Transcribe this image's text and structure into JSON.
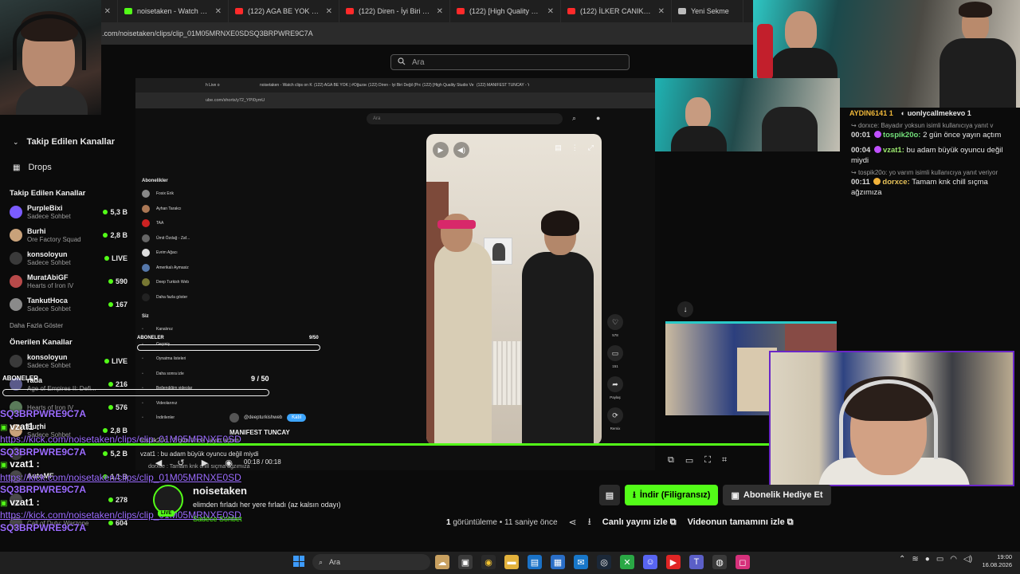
{
  "browser": {
    "tabs": [
      {
        "label": "ch",
        "color": "#2b2b2b"
      },
      {
        "label": "noisetaken - Watch clips",
        "color": "#53fc18"
      },
      {
        "label": "(122) AGA BE YOK #O",
        "color": "#ff2a2a"
      },
      {
        "label": "(122) Diren - İyi Biri Değil",
        "color": "#ff2a2a"
      },
      {
        "label": "(122) [High Quality Stud",
        "color": "#ff2a2a"
      },
      {
        "label": "(122) İLKER CANIKLIGİLI",
        "color": "#ff2a2a"
      },
      {
        "label": "Yeni Sekme",
        "color": "#bbbbbb"
      }
    ],
    "url": ".com/noisetaken/clips/clip_01M05MRNXE0SDSQ3BRPWRE9C7A",
    "search_placeholder": "Ara"
  },
  "sidebar": {
    "following_header": "Takip Edilen Kanallar",
    "drops": "Drops",
    "section_following": "Takip Edilen Kanallar",
    "following": [
      {
        "name": "PurpleBixi",
        "category": "Sadece Sohbet",
        "viewers": "5,3 B",
        "color": "#7b5cff"
      },
      {
        "name": "Burhi",
        "category": "Ore Factory Squad",
        "viewers": "2,8 B",
        "color": "#c9a27a"
      },
      {
        "name": "konsoloyun",
        "category": "Sadece Sohbet",
        "viewers": "LIVE",
        "color": "#3a3a3a"
      },
      {
        "name": "MuratAbiGF",
        "category": "Hearts of Iron IV",
        "viewers": "590",
        "color": "#b84a4a"
      },
      {
        "name": "TankutHoca",
        "category": "Sadece Sohbet",
        "viewers": "167",
        "color": "#8a8a8a"
      }
    ],
    "show_more": "Daha Fazla Göster",
    "section_recommended": "Önerilen Kanallar",
    "recommended": [
      {
        "name": "konsoloyun",
        "category": "Sadece Sohbet",
        "viewers": "LIVE",
        "color": "#3a3a3a"
      },
      {
        "name": "rada",
        "category": "Age of Empires II: Defi...",
        "viewers": "216",
        "color": "#5a5a8a"
      },
      {
        "name": "",
        "category": "Hearts of Iron IV",
        "viewers": "576",
        "color": "#5a7a5a"
      },
      {
        "name": "Burhi",
        "category": "Sadece Sohbet",
        "viewers": "2,8 B",
        "color": "#c9a27a"
      },
      {
        "name": "",
        "category": "",
        "viewers": "5,2 B",
        "color": "#3a3a3a"
      },
      {
        "name": "AutoMF",
        "category": "",
        "viewers": "1,1 B",
        "color": "#4a4a4a"
      },
      {
        "name": "",
        "category": "",
        "viewers": "278",
        "color": "#4a4a4a"
      },
      {
        "name": "",
        "category": "Call of Duty: Warzone",
        "viewers": "604",
        "color": "#4a4a4a"
      }
    ]
  },
  "chat": {
    "top_user_a": "AYDIN6141",
    "top_count_a": "1",
    "top_user_b": "uonlycallmekevo",
    "top_count_b": "1",
    "messages": [
      {
        "reply": "dorxce: Bayadır yoksun isimli kullanıcıya yanıt v",
        "time": "00:01",
        "user": "tospik20o:",
        "text": "2 gün önce yayın açtım",
        "badge": "#c050ff",
        "ucls": "u1"
      },
      {
        "reply": "",
        "time": "00:04",
        "user": "vzat1:",
        "text": "bu adam büyük oyuncu değil miydi",
        "badge": "#c050ff",
        "ucls": "u2"
      },
      {
        "reply": "tospik20o: yo varım isimli kullanıcıya yanıt veriyor",
        "time": "00:11",
        "user": "dorxce:",
        "text": "Tamam knk chill sıçma ağzımıza",
        "badge": "#f2b33a",
        "ucls": "u3"
      }
    ]
  },
  "shot": {
    "tabs": [
      "h Live o",
      "noisetaken - Watch clips on Ki",
      "(122) AGA BE YOK | #Oğuzse",
      "(122) Diren - İyi Biri Değil (Pro",
      "(122) [High Quality Studio Ve",
      "(122) MANIFEST TUNCAY - Yo"
    ],
    "url": "ube.com/shorts/y72_YPI0ymU",
    "search": "Ara",
    "subs_title": "Abonelikler",
    "subs": [
      {
        "name": "Fosix Erik",
        "color": "#888888"
      },
      {
        "name": "Ayhan Tarakcı",
        "color": "#aa7755"
      },
      {
        "name": "TAA",
        "color": "#cc2222"
      },
      {
        "name": "Ümit Özdağ - Zaf...",
        "color": "#666666"
      },
      {
        "name": "Evrim Ağacı",
        "color": "#dddddd"
      },
      {
        "name": "Amerikalı Aymasiz",
        "color": "#5577aa"
      },
      {
        "name": "Deep Turkish Web",
        "color": "#777733"
      },
      {
        "name": "Daha fazla göster",
        "color": "#222222"
      }
    ],
    "you_title": "Siz",
    "you_items": [
      "Kanalınız",
      "Geçmiş",
      "Oynatma listeleri",
      "Daha sonra izle",
      "Beğendiğim videolar",
      "Videolarınız",
      "İndirilenler"
    ],
    "likes": "578",
    "comments": "151",
    "share": "Paylaş",
    "remix": "Remix",
    "channel": "@deepturkishweb",
    "subscribe": "Katıl",
    "short_title": "MANIFEST TUNCAY",
    "time_display": "00:18 / 00:18"
  },
  "overlay": {
    "label": "ABONELER",
    "label2": "ABONELER",
    "count": "9/50",
    "count2": "9 / 50",
    "count3": "9 / 50",
    "small_chat_1": "tospik20o : 2 gün önce yayın açtım",
    "small_chat_2": "vzat1 : bu adam büyük oyuncu değil miydi",
    "small_chat_3": "dorxce : Tamam knk chill sıçma ağzımıza",
    "lines": [
      {
        "type": "code",
        "text": "SQ3BRPWRE9C7A"
      },
      {
        "type": "user",
        "text": "vzat1 :"
      },
      {
        "type": "link",
        "text": "https://kick.com/noisetaken/clips/clip_01M05MRNXE0SD"
      },
      {
        "type": "code",
        "text": "SQ3BRPWRE9C7A"
      },
      {
        "type": "user",
        "text": "vzat1 :"
      },
      {
        "type": "link",
        "text": "https://kick.com/noisetaken/clips/clip_01M05MRNXE0SD"
      },
      {
        "type": "code",
        "text": "SQ3BRPWRE9C7A"
      },
      {
        "type": "user",
        "text": "vzat1 :"
      },
      {
        "type": "link",
        "text": "https://kick.com/noisetaken/clips/clip_01M05MRNXE0SD"
      },
      {
        "type": "code",
        "text": "SQ3BRPWRE9C7A"
      }
    ]
  },
  "video": {
    "progress": 1.0,
    "streamer_name": "noisetaken",
    "stream_title": "elimden fırladı her yere fırladı (az kalsın odayı)",
    "category": "Sadece Sohbet",
    "live": "LIVE",
    "download_label": "İndir (Filigransız)",
    "gift_label": "Abonelik Hediye Et",
    "views_count": "1",
    "views_label": "görüntüleme",
    "age": "11 saniye önce",
    "watch_live": "Canlı yayını izle",
    "watch_full": "Videonun tamamını izle"
  },
  "taskbar": {
    "search": "Ara",
    "time": "19:00",
    "date": "16.08.2026"
  }
}
